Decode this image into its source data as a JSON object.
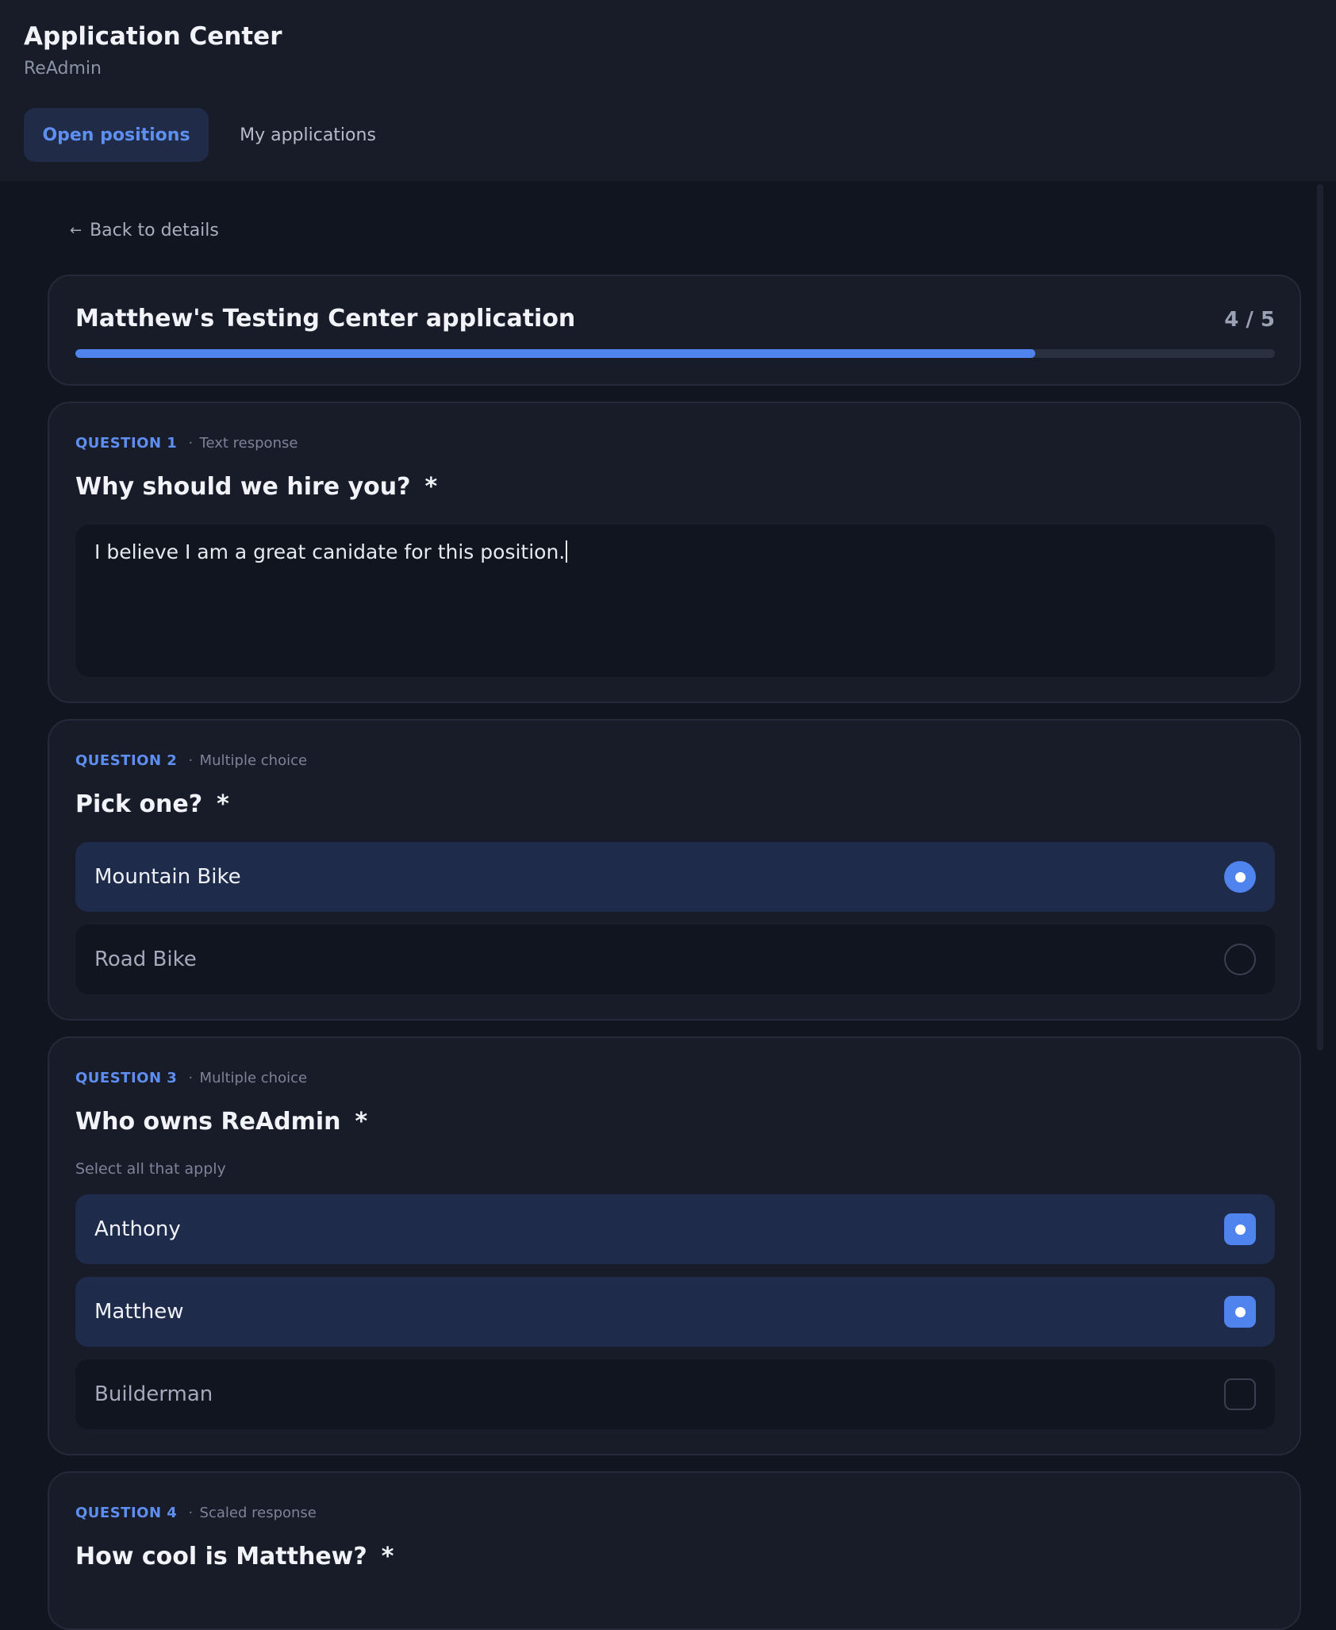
{
  "header": {
    "title": "Application Center",
    "subtitle": "ReAdmin",
    "tabs": [
      {
        "label": "Open positions",
        "active": true
      },
      {
        "label": "My applications",
        "active": false
      }
    ]
  },
  "back_link": {
    "label": "Back to details"
  },
  "application": {
    "title": "Matthew's Testing Center application",
    "step_text": "4 / 5",
    "progress_fraction": 0.8
  },
  "questions": [
    {
      "label": "QUESTION 1",
      "kind": "Text response",
      "title": "Why should we hire you?",
      "required_mark": "*",
      "answer": "I believe I am a great canidate for this position."
    },
    {
      "label": "QUESTION 2",
      "kind": "Multiple choice",
      "title": "Pick one?",
      "required_mark": "*",
      "options": [
        {
          "label": "Mountain Bike",
          "selected": true
        },
        {
          "label": "Road Bike",
          "selected": false
        }
      ]
    },
    {
      "label": "QUESTION 3",
      "kind": "Multiple choice",
      "title": "Who owns ReAdmin",
      "required_mark": "*",
      "hint": "Select all that apply",
      "options": [
        {
          "label": "Anthony",
          "selected": true
        },
        {
          "label": "Matthew",
          "selected": true
        },
        {
          "label": "Builderman",
          "selected": false
        }
      ]
    },
    {
      "label": "QUESTION 4",
      "kind": "Scaled response",
      "title": "How cool is Matthew?",
      "required_mark": "*"
    }
  ],
  "colors": {
    "accent": "#4f83ee",
    "background": "#111520",
    "card": "#181c28",
    "selected_option": "#1f2b4b"
  }
}
